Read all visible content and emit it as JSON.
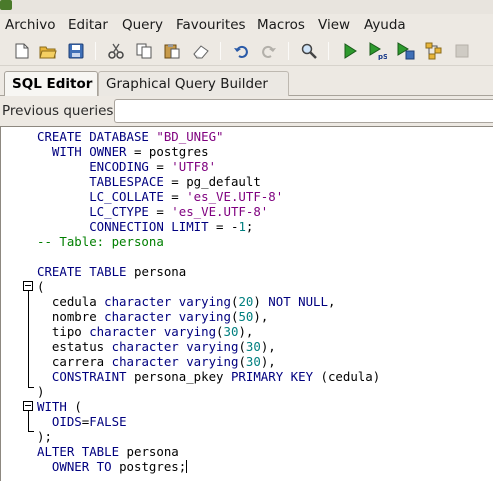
{
  "menubar": {
    "items": [
      "Archivo",
      "Editar",
      "Query",
      "Favourites",
      "Macros",
      "View",
      "Ayuda"
    ]
  },
  "toolbar": {
    "icons": [
      "new-file-icon",
      "open-folder-icon",
      "save-icon",
      "cut-icon",
      "copy-icon",
      "paste-icon",
      "eraser-icon",
      "undo-icon",
      "redo-icon",
      "find-icon",
      "execute-icon",
      "execute-pgscript-icon",
      "execute-to-file-icon",
      "explain-icon",
      "cancel-icon"
    ]
  },
  "tabs": {
    "sql_editor": "SQL Editor",
    "graphical_query_builder": "Graphical Query Builder"
  },
  "previous_queries": {
    "label": "Previous queries",
    "value": ""
  },
  "editor": {
    "lines": [
      [
        [
          "kw",
          "CREATE DATABASE "
        ],
        [
          "str",
          "\"BD_UNEG\""
        ]
      ],
      [
        [
          "kw",
          "  WITH OWNER "
        ],
        [
          "op",
          "= "
        ],
        [
          "id",
          "postgres"
        ]
      ],
      [
        [
          "kw",
          "       ENCODING "
        ],
        [
          "op",
          "= "
        ],
        [
          "str",
          "'UTF8'"
        ]
      ],
      [
        [
          "kw",
          "       TABLESPACE "
        ],
        [
          "op",
          "= "
        ],
        [
          "id",
          "pg_default"
        ]
      ],
      [
        [
          "kw",
          "       LC_COLLATE "
        ],
        [
          "op",
          "= "
        ],
        [
          "str",
          "'es_VE.UTF-8'"
        ]
      ],
      [
        [
          "kw",
          "       LC_CTYPE "
        ],
        [
          "op",
          "= "
        ],
        [
          "str",
          "'es_VE.UTF-8'"
        ]
      ],
      [
        [
          "kw",
          "       CONNECTION LIMIT "
        ],
        [
          "op",
          "= -"
        ],
        [
          "num",
          "1"
        ],
        [
          "op",
          ";"
        ]
      ],
      [
        [
          "com",
          "-- Table: persona"
        ]
      ],
      [],
      [
        [
          "kw",
          "CREATE TABLE "
        ],
        [
          "id",
          "persona"
        ]
      ],
      [
        [
          "op",
          "("
        ]
      ],
      [
        [
          "id",
          "  cedula "
        ],
        [
          "kw",
          "character varying"
        ],
        [
          "op",
          "("
        ],
        [
          "num",
          "20"
        ],
        [
          "op",
          ") "
        ],
        [
          "kw",
          "NOT NULL"
        ],
        [
          "op",
          ","
        ]
      ],
      [
        [
          "id",
          "  nombre "
        ],
        [
          "kw",
          "character varying"
        ],
        [
          "op",
          "("
        ],
        [
          "num",
          "50"
        ],
        [
          "op",
          "),"
        ]
      ],
      [
        [
          "id",
          "  tipo "
        ],
        [
          "kw",
          "character varying"
        ],
        [
          "op",
          "("
        ],
        [
          "num",
          "30"
        ],
        [
          "op",
          "),"
        ]
      ],
      [
        [
          "id",
          "  estatus "
        ],
        [
          "kw",
          "character varying"
        ],
        [
          "op",
          "("
        ],
        [
          "num",
          "30"
        ],
        [
          "op",
          "),"
        ]
      ],
      [
        [
          "id",
          "  carrera "
        ],
        [
          "kw",
          "character varying"
        ],
        [
          "op",
          "("
        ],
        [
          "num",
          "30"
        ],
        [
          "op",
          "),"
        ]
      ],
      [
        [
          "kw",
          "  CONSTRAINT "
        ],
        [
          "id",
          "persona_pkey "
        ],
        [
          "kw",
          "PRIMARY KEY "
        ],
        [
          "op",
          "("
        ],
        [
          "id",
          "cedula"
        ],
        [
          "op",
          ")"
        ]
      ],
      [
        [
          "op",
          ")"
        ]
      ],
      [
        [
          "kw",
          "WITH "
        ],
        [
          "op",
          "("
        ]
      ],
      [
        [
          "kw",
          "  OIDS"
        ],
        [
          "op",
          "="
        ],
        [
          "kw",
          "FALSE"
        ]
      ],
      [
        [
          "op",
          ");"
        ]
      ],
      [
        [
          "kw",
          "ALTER TABLE "
        ],
        [
          "id",
          "persona"
        ]
      ],
      [
        [
          "kw",
          "  OWNER TO "
        ],
        [
          "id",
          "postgres"
        ],
        [
          "op",
          ";"
        ]
      ]
    ]
  },
  "colors": {
    "keyword": "#00007f",
    "string": "#7f007f",
    "number": "#007f7f",
    "comment": "#007f00"
  }
}
